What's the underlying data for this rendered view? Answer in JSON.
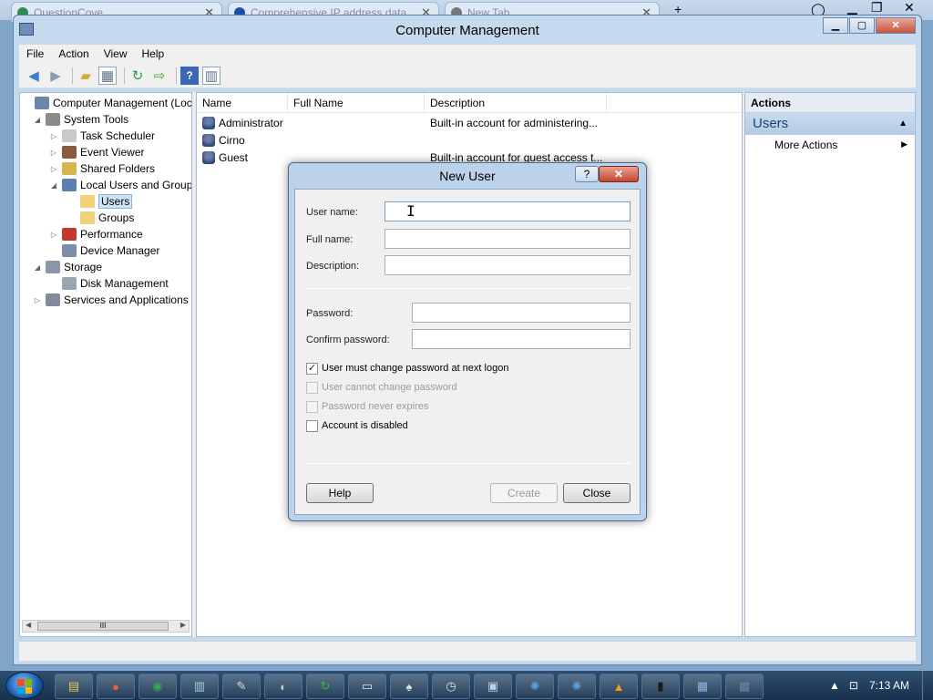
{
  "browser": {
    "tabs": [
      {
        "label": "QuestionCove",
        "icon_color": "#2e8b57"
      },
      {
        "label": "Comprehensive IP address data,",
        "icon_color": "#1e4fa8"
      },
      {
        "label": "New Tab",
        "icon_color": "#777777"
      }
    ],
    "new_tab_glyph": "+"
  },
  "window": {
    "title": "Computer Management",
    "minimize_glyph": "▁",
    "maximize_glyph": "▢",
    "close_glyph": "✕"
  },
  "menu": [
    "File",
    "Action",
    "View",
    "Help"
  ],
  "toolbar": {
    "icons": [
      "back-arrow-icon",
      "forward-arrow-icon",
      "up-folder-icon",
      "show-hide-tree-icon",
      "refresh-icon",
      "export-list-icon",
      "help-icon",
      "properties-icon"
    ]
  },
  "tree": {
    "nodes": [
      {
        "label": "Computer Management (Local",
        "level": 0,
        "arrow": "",
        "icon": "computer-management-icon",
        "color": "#6b86ad"
      },
      {
        "label": "System Tools",
        "level": 1,
        "arrow": "◢",
        "icon": "tools-icon",
        "color": "#8a8a8a"
      },
      {
        "label": "Task Scheduler",
        "level": 2,
        "arrow": "▷",
        "icon": "clock-icon",
        "color": "#c9c9c9"
      },
      {
        "label": "Event Viewer",
        "level": 2,
        "arrow": "▷",
        "icon": "event-viewer-icon",
        "color": "#8a5a3a"
      },
      {
        "label": "Shared Folders",
        "level": 2,
        "arrow": "▷",
        "icon": "shared-folder-icon",
        "color": "#d8b44a"
      },
      {
        "label": "Local Users and Groups",
        "level": 2,
        "arrow": "◢",
        "icon": "users-groups-icon",
        "color": "#5d7fb0"
      },
      {
        "label": "Users",
        "level": 3,
        "arrow": "",
        "icon": "folder-icon",
        "color": "#f1d27a",
        "selected": true
      },
      {
        "label": "Groups",
        "level": 3,
        "arrow": "",
        "icon": "folder-icon",
        "color": "#f1d27a"
      },
      {
        "label": "Performance",
        "level": 2,
        "arrow": "▷",
        "icon": "performance-icon",
        "color": "#c0392b"
      },
      {
        "label": "Device Manager",
        "level": 2,
        "arrow": "",
        "icon": "device-manager-icon",
        "color": "#7d8fa6"
      },
      {
        "label": "Storage",
        "level": 1,
        "arrow": "◢",
        "icon": "storage-icon",
        "color": "#8a97a8"
      },
      {
        "label": "Disk Management",
        "level": 2,
        "arrow": "",
        "icon": "disk-icon",
        "color": "#9aa5b3"
      },
      {
        "label": "Services and Applications",
        "level": 1,
        "arrow": "▷",
        "icon": "services-icon",
        "color": "#7e8c9c"
      }
    ],
    "scrollbar_grip": "III"
  },
  "list": {
    "columns": [
      "Name",
      "Full Name",
      "Description"
    ],
    "rows": [
      {
        "name": "Administrator",
        "full_name": "",
        "description": "Built-in account for administering..."
      },
      {
        "name": "Cirno",
        "full_name": "",
        "description": ""
      },
      {
        "name": "Guest",
        "full_name": "",
        "description": "Built-in account for guest access t..."
      }
    ]
  },
  "actions": {
    "title": "Actions",
    "group": "Users",
    "items": [
      "More Actions"
    ]
  },
  "dialog": {
    "title": "New User",
    "help_glyph": "?",
    "close_glyph": "✕",
    "fields": {
      "user_name_label": "User name:",
      "full_name_label": "Full name:",
      "description_label": "Description:",
      "password_label": "Password:",
      "confirm_password_label": "Confirm password:",
      "user_name_value": "",
      "full_name_value": "",
      "description_value": "",
      "password_value": "",
      "confirm_password_value": ""
    },
    "checkboxes": [
      {
        "label": "User must change password at next logon",
        "checked": true,
        "disabled": false
      },
      {
        "label": "User cannot change password",
        "checked": false,
        "disabled": true
      },
      {
        "label": "Password never expires",
        "checked": false,
        "disabled": true
      },
      {
        "label": "Account is disabled",
        "checked": false,
        "disabled": false
      }
    ],
    "buttons": {
      "help": "Help",
      "create": "Create",
      "close": "Close"
    }
  },
  "taskbar": {
    "items": [
      {
        "name": "explorer-task",
        "glyph": "▤",
        "color": "#e8c45a"
      },
      {
        "name": "firefox-task",
        "glyph": "●",
        "color": "#e5642b"
      },
      {
        "name": "chrome-task",
        "glyph": "◉",
        "color": "#3aa757"
      },
      {
        "name": "notepad-task",
        "glyph": "▥",
        "color": "#9fd3e8"
      },
      {
        "name": "paint-task",
        "glyph": "✎",
        "color": "#d8d8d8"
      },
      {
        "name": "media-task",
        "glyph": "◐",
        "color": "#c8c8c8"
      },
      {
        "name": "refresh-app-task",
        "glyph": "↻",
        "color": "#49b24a"
      },
      {
        "name": "document-task",
        "glyph": "▭",
        "color": "#d7e6f5"
      },
      {
        "name": "cards-task",
        "glyph": "♠",
        "color": "#e0e0e0"
      },
      {
        "name": "clock-task",
        "glyph": "◷",
        "color": "#e0e0e0"
      },
      {
        "name": "image-task",
        "glyph": "▣",
        "color": "#b8d0ea"
      },
      {
        "name": "network-task",
        "glyph": "✺",
        "color": "#5aa0d8"
      },
      {
        "name": "network2-task",
        "glyph": "✺",
        "color": "#5aa0d8"
      },
      {
        "name": "vlc-task",
        "glyph": "▲",
        "color": "#f39a1e"
      },
      {
        "name": "cmd-task",
        "glyph": "▮",
        "color": "#1a1a1a"
      },
      {
        "name": "remote-task",
        "glyph": "▦",
        "color": "#8fb6e0"
      },
      {
        "name": "computer-management-task",
        "glyph": "▩",
        "color": "#6b86ad"
      }
    ],
    "tray_up": "▲",
    "tray_network": "⊡",
    "clock": "7:13 AM"
  }
}
